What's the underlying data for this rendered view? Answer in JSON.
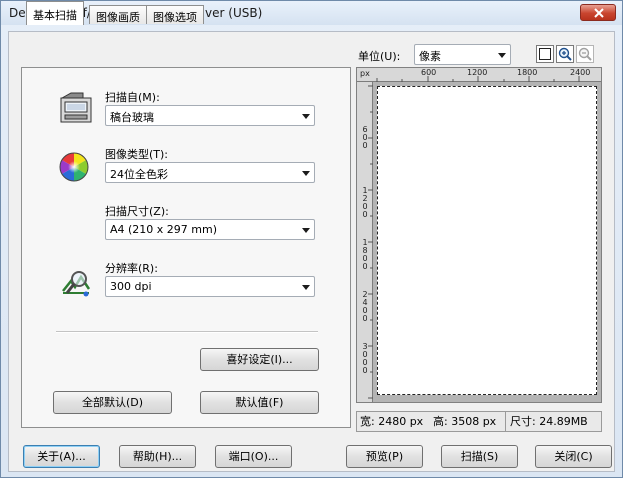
{
  "window": {
    "title": "Dell C1765nf/nfw MFP TWAIN Driver (USB)"
  },
  "tabs": [
    {
      "label": "基本扫描"
    },
    {
      "label": "图像画质"
    },
    {
      "label": "图像选项"
    }
  ],
  "basic_scan": {
    "scan_from": {
      "label": "扫描自(M):",
      "value": "稿台玻璃"
    },
    "image_type": {
      "label": "图像类型(T):",
      "value": "24位全色彩"
    },
    "scan_size": {
      "label": "扫描尺寸(Z):",
      "value": "A4 (210 x 297 mm)"
    },
    "resolution": {
      "label": "分辨率(R):",
      "value": "300 dpi"
    },
    "preferences_button": "喜好设定(I)...",
    "all_defaults_button": "全部默认(D)",
    "defaults_button": "默认值(F)"
  },
  "preview": {
    "unit_label": "单位(U):",
    "unit_value": "像素",
    "ruler_unit": "px",
    "ruler_top_ticks": [
      "600",
      "1200",
      "1800",
      "2400"
    ],
    "ruler_left_ticks": [
      "600",
      "1200",
      "1800",
      "2400",
      "3000"
    ]
  },
  "status": {
    "width": "宽: 2480 px",
    "height": "高: 3508 px",
    "size": "尺寸: 24.89MB"
  },
  "footer": {
    "about": "关于(A)...",
    "help": "帮助(H)...",
    "port": "端口(O)...",
    "preview": "预览(P)",
    "scan": "扫描(S)",
    "close": "关闭(C)"
  },
  "icons": {
    "close": "close-icon",
    "scanner": "scanner-icon",
    "color_wheel": "color-wheel-icon",
    "resolution": "magnifier-resolution-icon",
    "select_all": "select-all-icon",
    "zoom_in": "zoom-in-icon",
    "zoom_out": "zoom-out-icon"
  }
}
